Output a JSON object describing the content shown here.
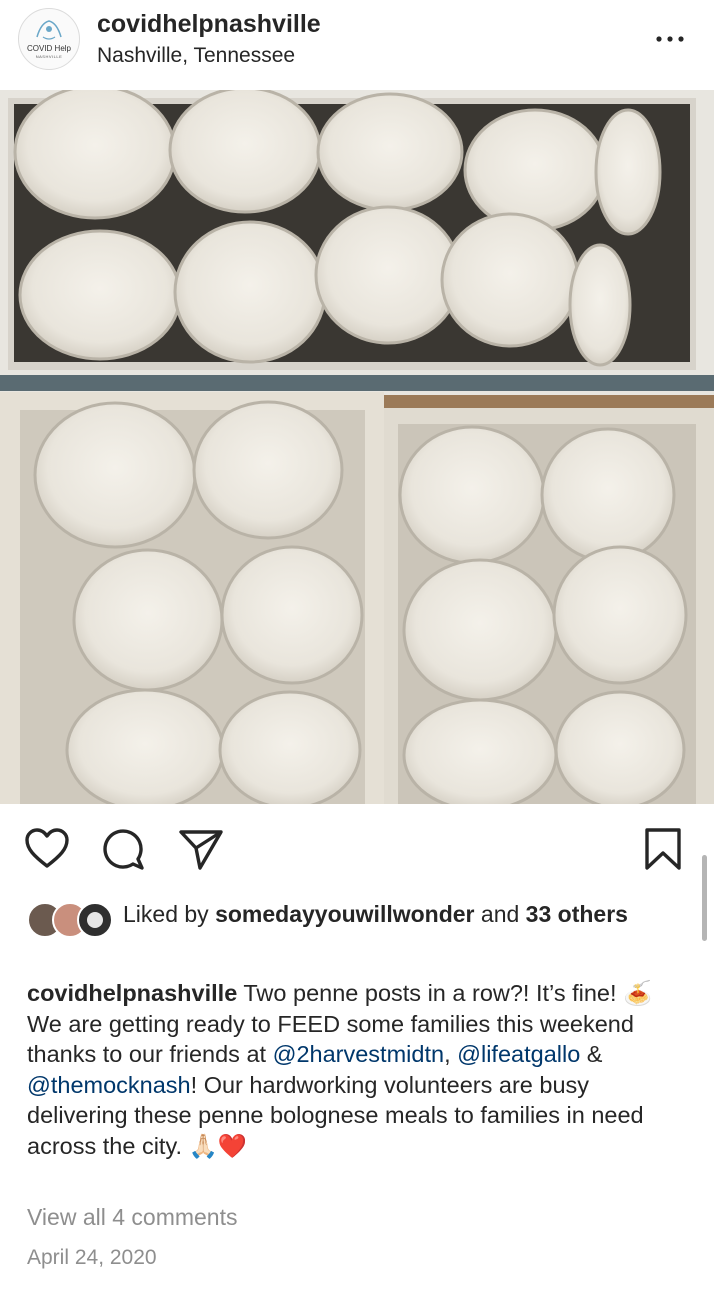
{
  "post": {
    "username": "covidhelpnashville",
    "location": "Nashville, Tennessee",
    "avatar_text": "COVID Help",
    "avatar_subtext": "NASHVILLE"
  },
  "likes": {
    "prefix": "Liked by ",
    "user": "somedayyouwillwonder",
    "middle": " and ",
    "others": "33 others"
  },
  "caption": {
    "username": "covidhelpnashville",
    "text_1": " Two penne posts in a row?! It’s fine! 🍝 We are getting ready to FEED some families this weekend thanks to our friends at ",
    "mention_1": "@2harvestmidtn",
    "sep_1": ", ",
    "mention_2": "@lifeatgallo",
    "sep_2": " & ",
    "mention_3": "@themocknash",
    "text_2": "! Our hardworking volunteers are busy delivering these penne bolognese meals to families in need across the city. 🙏🏻❤️"
  },
  "view_comments": "View all 4 comments",
  "date": "April 24, 2020",
  "icons": {
    "more": "more-options-icon",
    "like": "heart-icon",
    "comment": "comment-icon",
    "share": "share-icon",
    "save": "bookmark-icon"
  },
  "colors": {
    "text": "#262626",
    "mention": "#00376b",
    "secondary": "#8e8e8e"
  }
}
